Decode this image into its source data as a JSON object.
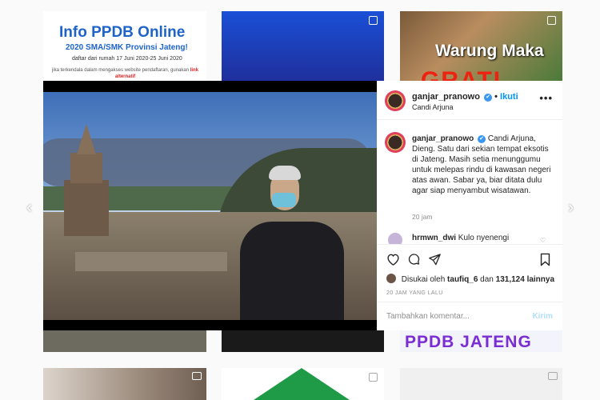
{
  "grid": {
    "tile1": {
      "title": "Info PPDB Online",
      "subtitle": "2020 SMA/SMK Provinsi Jateng!",
      "dates": "daftar dari rumah 17 Juni 2020-25 Juni 2020",
      "note": "jika terkendala dalam mengakses website pendaftaran, gunakan",
      "note_link": "link alternatif"
    },
    "tile3": {
      "line1": "Warung Maka",
      "line2": "GRATI"
    },
    "tile6": {
      "text": "PPDB JATENG"
    }
  },
  "post": {
    "username": "ganjar_pranowo",
    "verified_mark": "✔",
    "dot": "•",
    "follow_label": "Ikuti",
    "location": "Candi Arjuna",
    "more_label": "•••",
    "caption_username": "ganjar_pranowo",
    "caption": "Candi Arjuna, Dieng. Satu dari sekian tempat eksotis di Jateng. Masih setia menunggumu untuk melepas rindu di kawasan negeri atas awan. Sabar ya, biar ditata dulu agar siap menyambut wisatawan.",
    "caption_time": "20 jam",
    "comment_username": "hrmwn_dwi",
    "comment_text": "Kulo nyenengi",
    "likes_prefix": "Disukai oleh",
    "likes_user": "taufiq_6",
    "likes_middle": "dan",
    "likes_count": "131,124 lainnya",
    "posted_ago": "20 JAM YANG LALU",
    "comment_placeholder": "Tambahkan komentar...",
    "send_label": "Kirim"
  },
  "nav": {
    "prev": "‹",
    "next": "›"
  },
  "icons": {
    "heart": "heart-icon",
    "comment": "comment-icon",
    "share": "share-icon",
    "save": "bookmark-icon"
  },
  "colors": {
    "accent": "#0095f6",
    "send_disabled": "#b2dffc"
  }
}
